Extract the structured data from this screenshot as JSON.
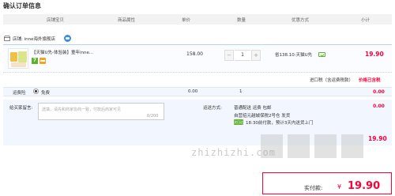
{
  "page_title": "确认订单信息",
  "columns": [
    "店铺宝贝",
    "商品属性",
    "单价",
    "数量",
    "优惠方式",
    "小计"
  ],
  "store": {
    "label": "店铺: inne海外旗舰店"
  },
  "item": {
    "title": "【天猫U先-体验装】童年inne...",
    "unit_price": "158.00",
    "quantity": "1",
    "minus": "−",
    "plus": "+",
    "promo": "省138.10:天猫U先",
    "subtotal": "19.90"
  },
  "import_tax": {
    "label": "进口税（含运费税款）",
    "value": "价格已含税"
  },
  "service": {
    "label": "运费险",
    "option": "免费",
    "price": "0.00",
    "quantity": "1",
    "subtotal": "0.00"
  },
  "message": {
    "label": "给买家留言:",
    "placeholder": "选填，请先和商家协商一致，付款后商家可见",
    "counter": "0/200"
  },
  "shipping": {
    "label": "运送方式:",
    "method": "普通配送 运费 包邮",
    "from": "自营招元越城保税2号仓 发货",
    "eta_tag": "次日达",
    "eta": "18:30前付款，预计3天内送货上门",
    "price": "0.00"
  },
  "store_total": {
    "label": "",
    "value": "19.90"
  },
  "watermark": "zhizhizhi.com",
  "payment": {
    "label": "实付款:",
    "currency": "¥",
    "amount": "19.90"
  },
  "colors": {
    "accent": "#ff0036",
    "header_bg": "#f2f2f2",
    "row_bg": "#f2f7ff",
    "tag_green": "#5db230"
  }
}
